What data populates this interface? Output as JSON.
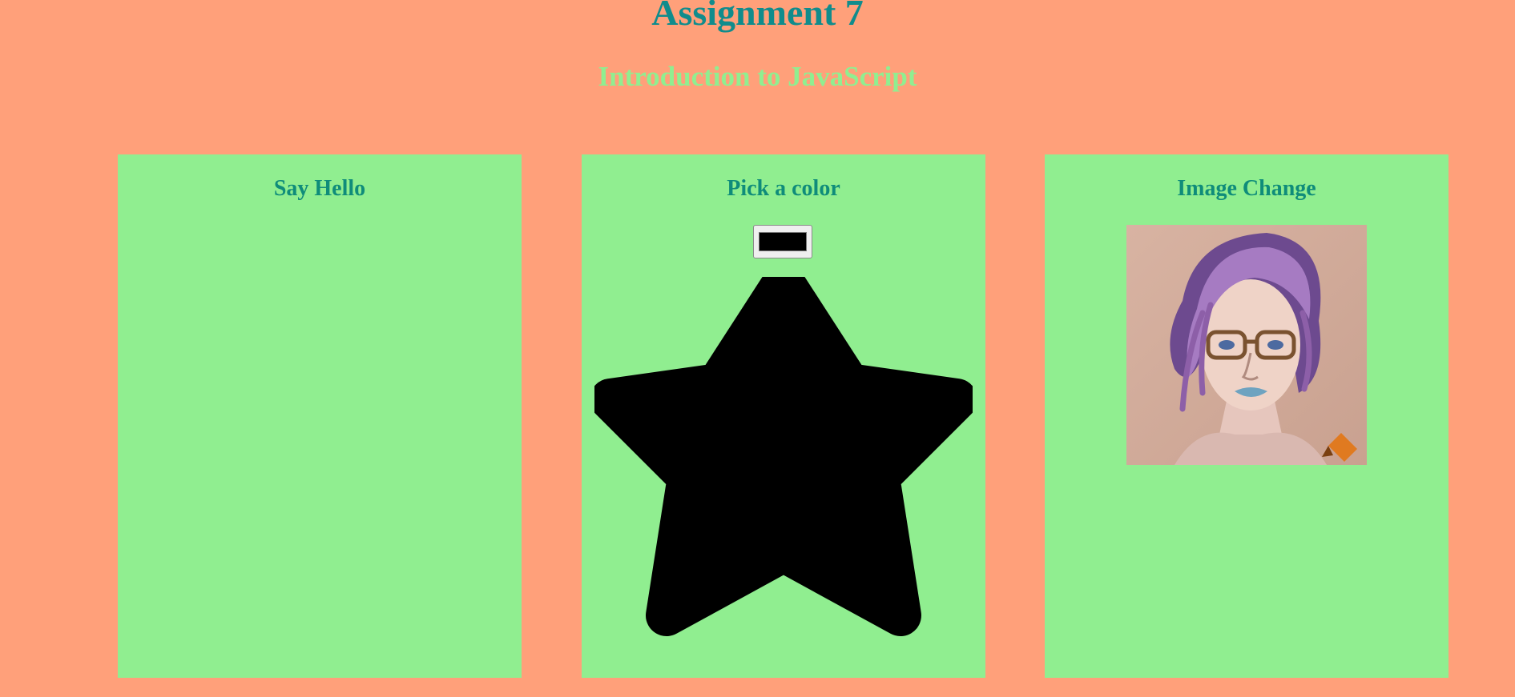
{
  "header": {
    "title": "Assignment 7",
    "subtitle": "Introduction to JavaScript"
  },
  "cards": [
    {
      "title": "Say Hello"
    },
    {
      "title": "Pick a color",
      "color_value": "#000000",
      "star_color": "#000000"
    },
    {
      "title": "Image Change",
      "image_icon": "portrait-image"
    }
  ],
  "colors": {
    "page_background": "#FFA07A",
    "card_background": "#90EE90",
    "title": "#108C8C",
    "subtitle": "#90EE90",
    "card_title": "#0F8C7A"
  }
}
